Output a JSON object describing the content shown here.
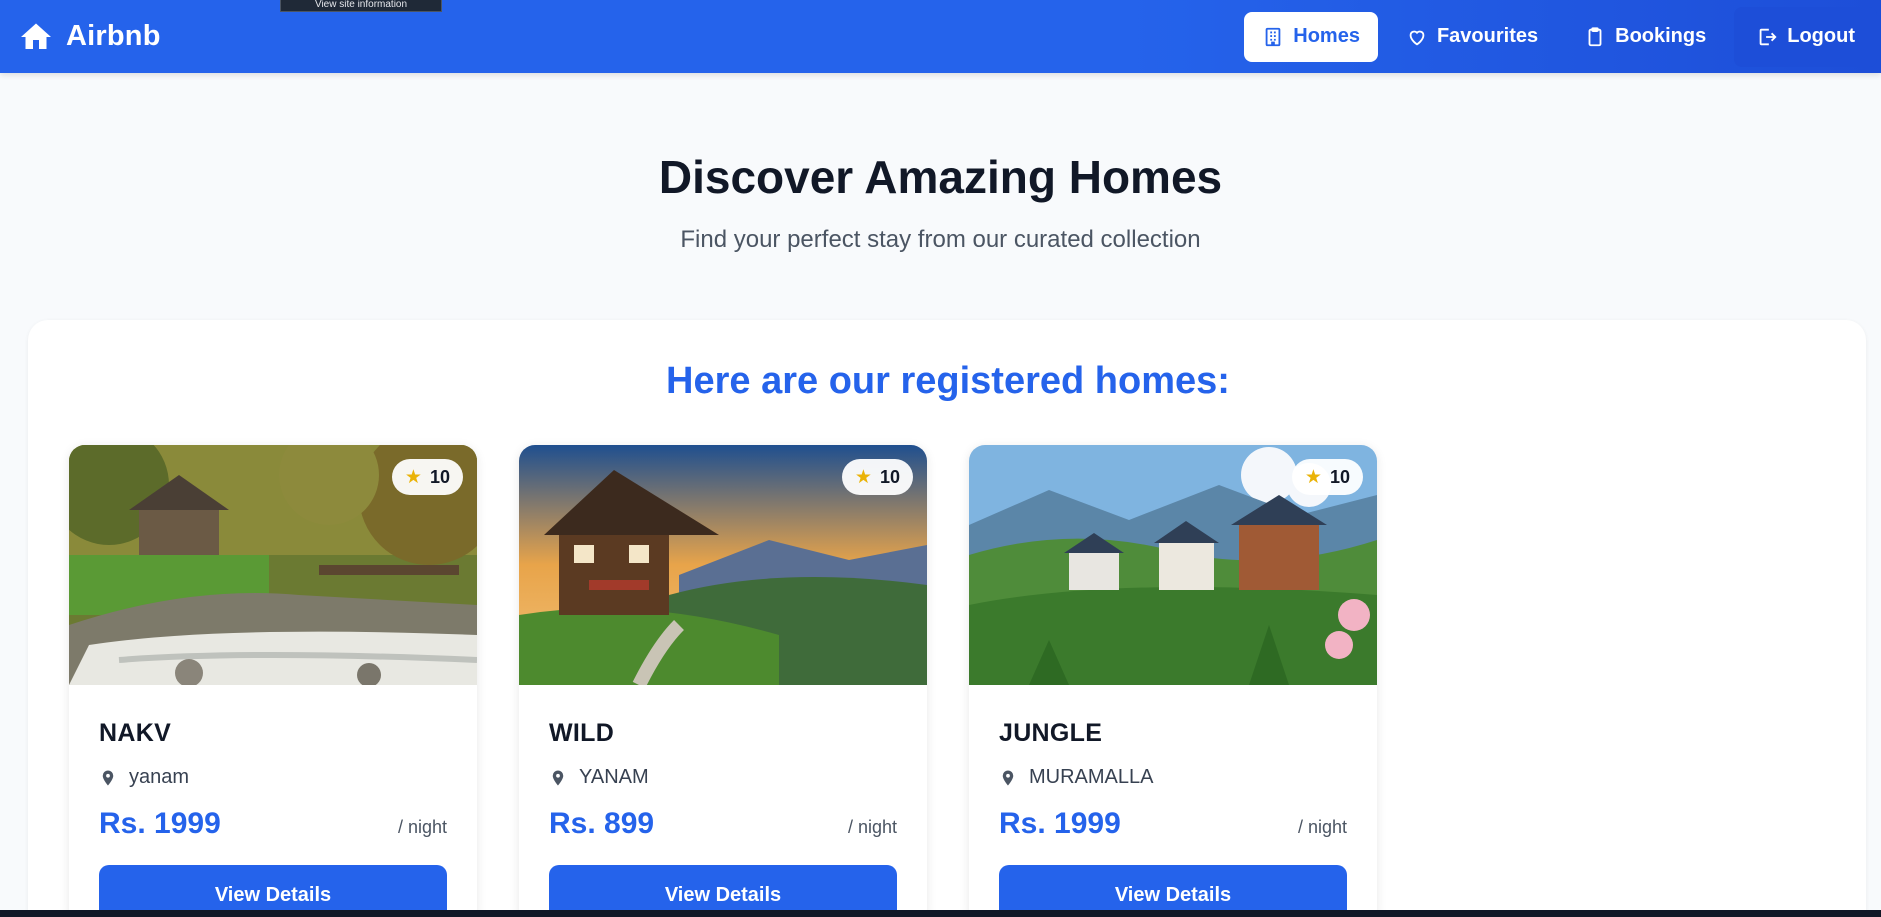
{
  "header": {
    "brand": "Airbnb",
    "tooltip": "View site information",
    "nav": [
      {
        "label": "Homes",
        "icon": "building-icon",
        "active": true
      },
      {
        "label": "Favourites",
        "icon": "heart-icon",
        "active": false
      },
      {
        "label": "Bookings",
        "icon": "clipboard-icon",
        "active": false
      },
      {
        "label": "Logout",
        "icon": "logout-icon",
        "active": false
      }
    ]
  },
  "hero": {
    "title": "Discover Amazing Homes",
    "subtitle": "Find your perfect stay from our curated collection"
  },
  "listing": {
    "heading": "Here are our registered homes:",
    "homes": [
      {
        "name": "NAKV",
        "location": "yanam",
        "price": "Rs. 1999",
        "per": "/ night",
        "rating": "10",
        "button": "View Details"
      },
      {
        "name": "WILD",
        "location": "YANAM",
        "price": "Rs. 899",
        "per": "/ night",
        "rating": "10",
        "button": "View Details"
      },
      {
        "name": "JUNGLE",
        "location": "MURAMALLA",
        "price": "Rs. 1999",
        "per": "/ night",
        "rating": "10",
        "button": "View Details"
      }
    ]
  },
  "colors": {
    "brand_blue": "#2563eb",
    "star": "#eab308",
    "text_dark": "#111827"
  }
}
